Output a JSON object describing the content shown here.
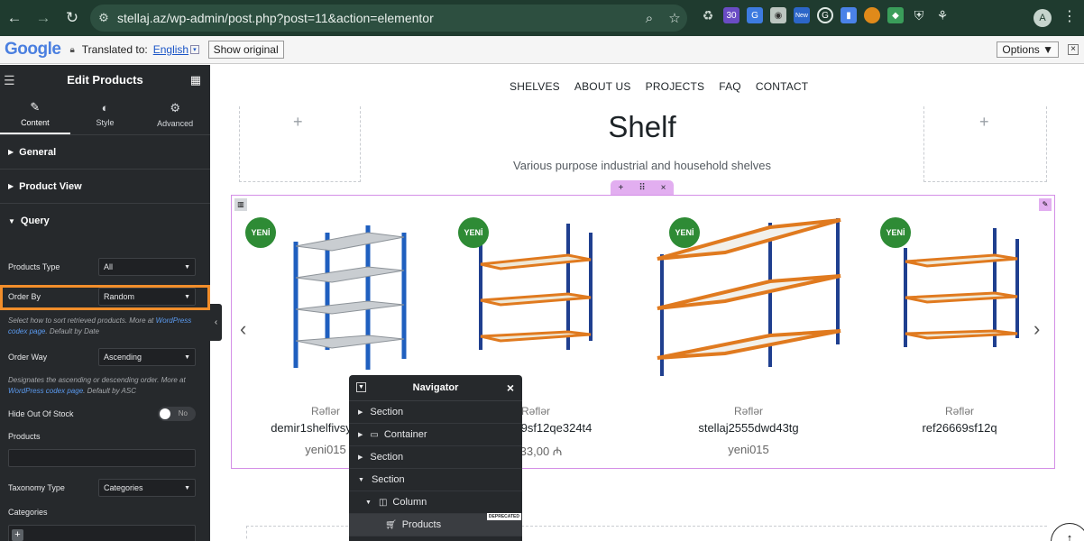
{
  "browser": {
    "url": "stellaj.az/wp-admin/post.php?post=11&action=elementor",
    "avatar_letter": "A",
    "ext_badge": "30",
    "ext_new": "New"
  },
  "translate": {
    "logo": "Google",
    "translated_to": "Translated to:",
    "language": "English",
    "show_original": "Show original",
    "options": "Options ▼"
  },
  "panel": {
    "title": "Edit Products",
    "tabs": [
      "Content",
      "Style",
      "Advanced"
    ],
    "sections": [
      "General",
      "Product View",
      "Query"
    ],
    "products_type_label": "Products Type",
    "products_type_value": "All",
    "order_by_label": "Order By",
    "order_by_value": "Random",
    "order_by_hint_a": "Select how to sort retrieved products. More at",
    "order_by_hint_link": "WordPress codex page",
    "order_by_hint_b": ". Default by Date",
    "order_way_label": "Order Way",
    "order_way_value": "Ascending",
    "order_way_hint_a": "Designates the ascending or descending order. More at",
    "order_way_hint_link": "WordPress codex page",
    "order_way_hint_b": ". Default by ASC",
    "hide_oos_label": "Hide Out Of Stock",
    "hide_oos_value": "No",
    "products_label": "Products",
    "taxonomy_label": "Taxonomy Type",
    "taxonomy_value": "Categories",
    "categories_label": "Categories"
  },
  "site": {
    "menu": [
      "SHELVES",
      "ABOUT US",
      "PROJECTS",
      "FAQ",
      "CONTACT"
    ],
    "heading": "Shelf",
    "subheading": "Various purpose industrial and household shelves",
    "badge": "YENİ",
    "products": [
      {
        "category": "Rəflər",
        "name": "demir1shelfivsy",
        "price": "yeni015"
      },
      {
        "category": "Rəflər",
        "name": "9sf12qe324t4",
        "price": "33,00 ₼"
      },
      {
        "category": "Rəflər",
        "name": "stellaj2555dwd43tg",
        "price": "yeni015"
      },
      {
        "category": "Rəflər",
        "name": "ref26669sf12q",
        "price": ""
      }
    ]
  },
  "navigator": {
    "title": "Navigator",
    "items": [
      "Section",
      "Container",
      "Section",
      "Section",
      "Column",
      "Products"
    ],
    "deprecated": "DEPRECATED"
  },
  "colors": {
    "accent": "#f28e2b",
    "badge": "#2e8b35",
    "panel": "#26292c",
    "selection": "#d48fe7"
  }
}
